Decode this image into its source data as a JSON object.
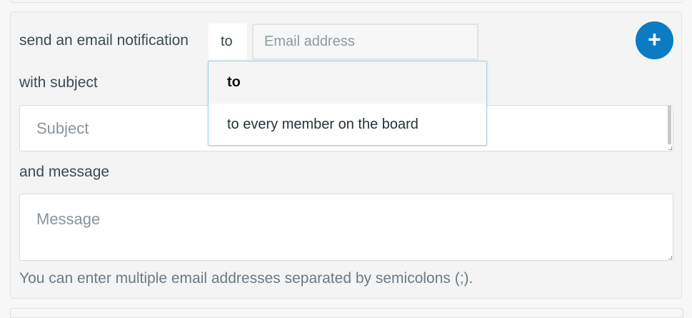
{
  "rule": {
    "action_label": "send an email notification",
    "recipient_select": {
      "selected": "to",
      "options": [
        "to",
        "to every member on the board"
      ]
    },
    "email_placeholder": "Email address",
    "add_button_icon": "plus-icon",
    "subject_label": "with subject",
    "subject_placeholder": "Subject",
    "message_label": "and message",
    "message_placeholder": "Message",
    "hint": "You can enter multiple email addresses separated by semicolons (;)."
  },
  "colors": {
    "accent": "#0b7bc4",
    "dropdown_border": "#9fd2ea"
  }
}
